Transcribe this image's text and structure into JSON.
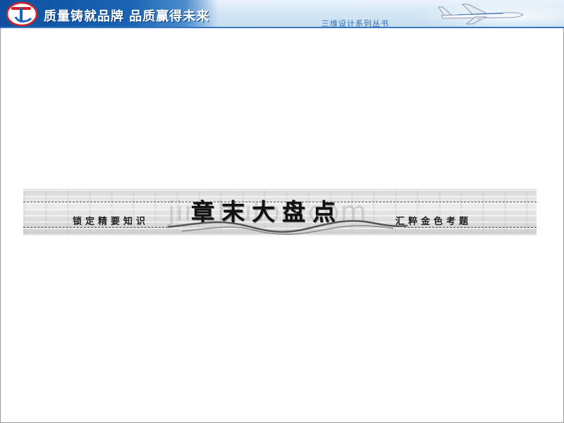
{
  "header": {
    "slogan": "质量铸就品牌 品质赢得未来",
    "series": "三维设计系列丛书",
    "logo_icon": "tc-logo-icon",
    "plane_icon": "airplane-icon",
    "colors": {
      "bar": "#1b64b4",
      "sky": "#d4e6f5",
      "series_text": "#2f6fb8"
    }
  },
  "banner": {
    "title": "章末大盘点",
    "left_caption": "锁定精要知识",
    "right_caption": "汇粹金色考题",
    "watermark": "jinchutou.com"
  }
}
